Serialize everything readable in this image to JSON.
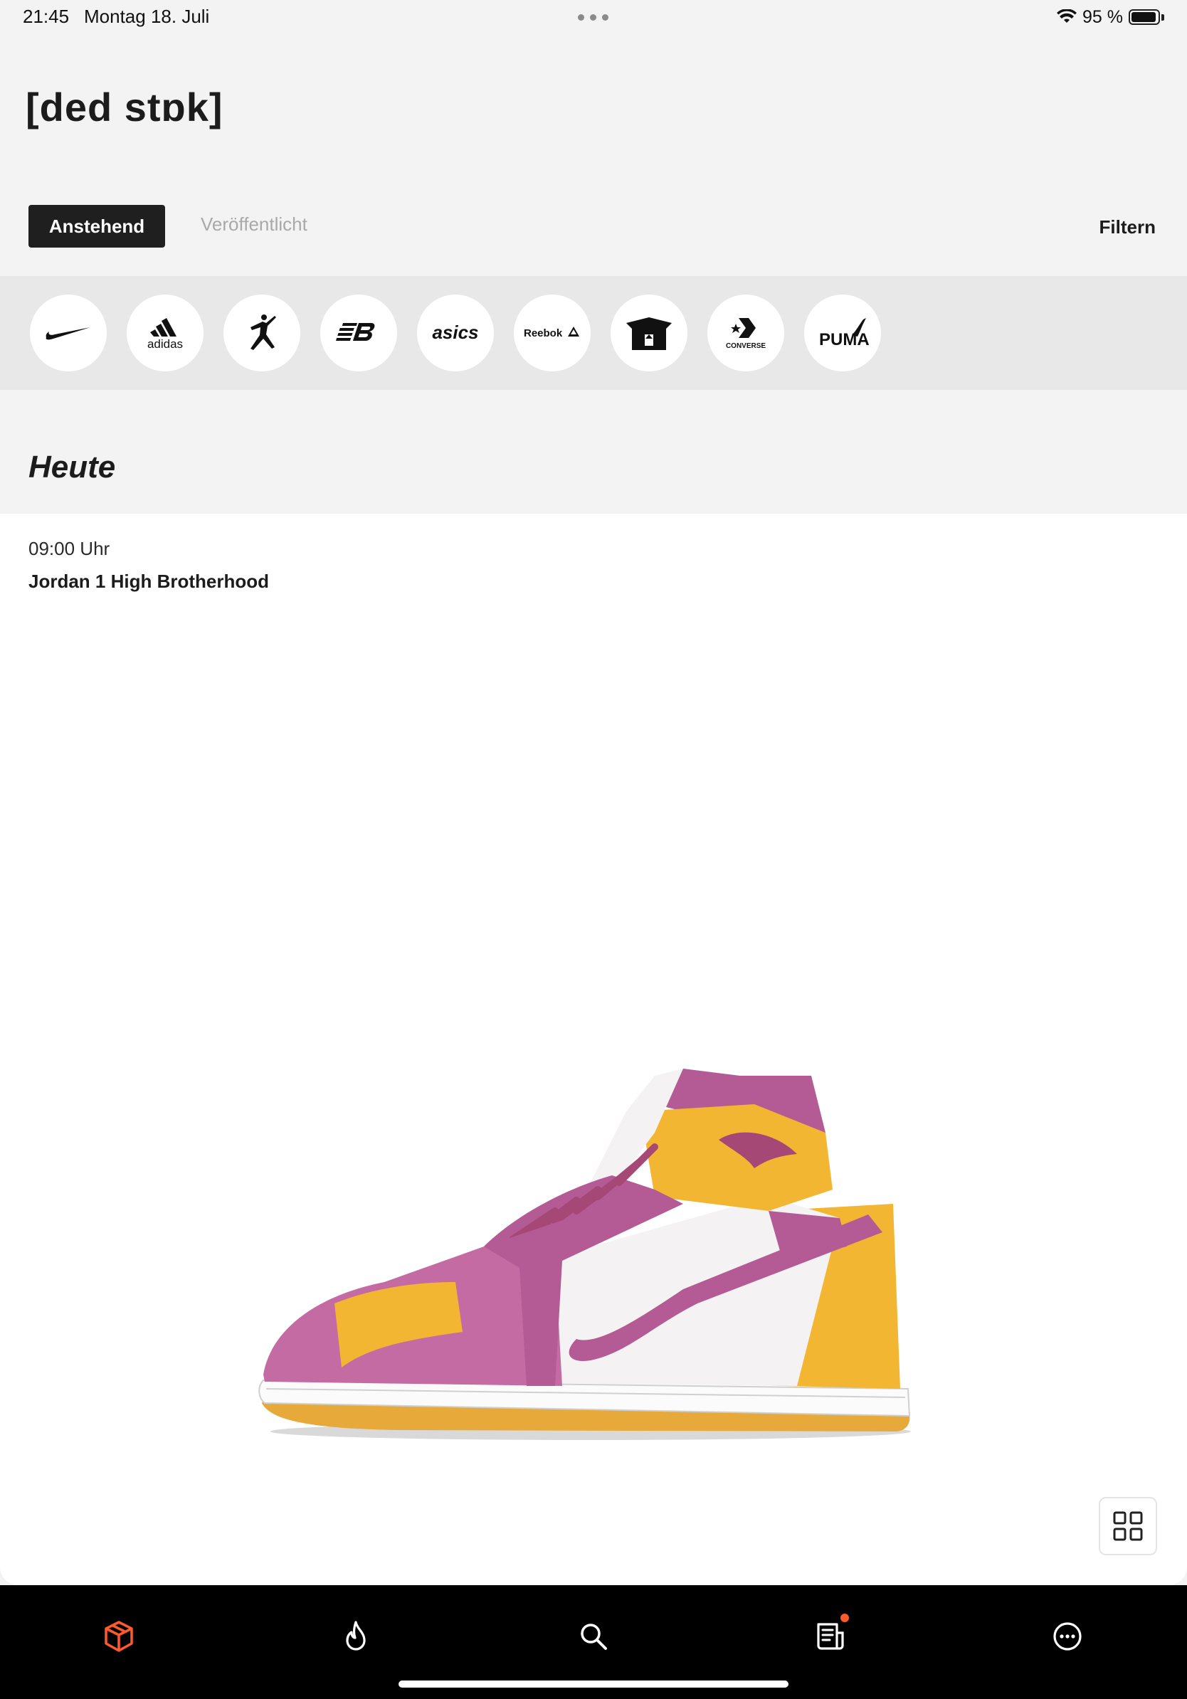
{
  "status_bar": {
    "time": "21:45",
    "date": "Montag 18. Juli",
    "battery_percent": "95 %",
    "battery_level": 0.95
  },
  "header": {
    "app_title": "[ded stɒk]"
  },
  "tabs": {
    "active_label": "Anstehend",
    "inactive_label": "Veröffentlicht"
  },
  "filter": {
    "label": "Filtern"
  },
  "brands": [
    {
      "name": "nike-logo"
    },
    {
      "name": "adidas-logo",
      "text": "adidas"
    },
    {
      "name": "jordan-jumpman-logo"
    },
    {
      "name": "new-balance-logo"
    },
    {
      "name": "asics-logo",
      "text": "asics"
    },
    {
      "name": "reebok-logo",
      "text": "Reebok"
    },
    {
      "name": "box-logo"
    },
    {
      "name": "converse-logo",
      "text": "CONVERSE"
    },
    {
      "name": "puma-logo",
      "text": "PUMA"
    }
  ],
  "section": {
    "title": "Heute"
  },
  "release": {
    "time": "09:00 Uhr",
    "name": "Jordan 1 High Brotherhood"
  },
  "colors": {
    "accent": "#ff5a2a",
    "sneaker_magenta": "#b45a95",
    "sneaker_yellow": "#f2b632"
  },
  "tabbar": {
    "items": [
      {
        "icon": "cube-icon",
        "active": true
      },
      {
        "icon": "flame-icon",
        "active": false
      },
      {
        "icon": "search-icon",
        "active": false
      },
      {
        "icon": "news-icon",
        "active": false,
        "badge": true
      },
      {
        "icon": "more-icon",
        "active": false
      }
    ]
  }
}
